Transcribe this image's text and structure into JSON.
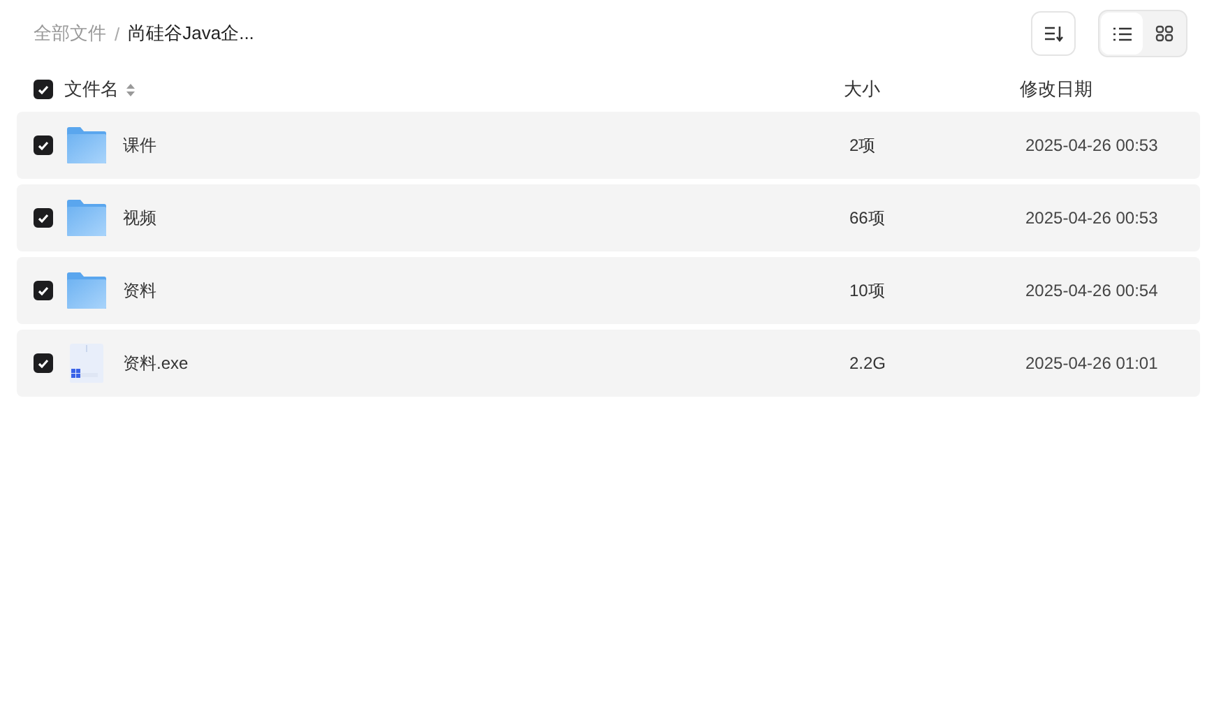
{
  "breadcrumb": [
    {
      "label": "全部文件",
      "current": false
    },
    {
      "label": "尚硅谷Java企...",
      "current": true
    }
  ],
  "breadcrumb_separator": "/",
  "view_modes": [
    {
      "kind": "list",
      "selected": true
    },
    {
      "kind": "grid",
      "selected": false
    }
  ],
  "table": {
    "select_all_checked": true,
    "columns": [
      {
        "label": "文件名",
        "sortable": true
      },
      {
        "label": "大小",
        "sortable": false
      },
      {
        "label": "修改日期",
        "sortable": false
      }
    ],
    "rows": [
      {
        "kind": "folder",
        "name": "课件",
        "size": "2项",
        "modified": "2025-04-26 00:53",
        "checked": true
      },
      {
        "kind": "folder",
        "name": "视频",
        "size": "66项",
        "modified": "2025-04-26 00:53",
        "checked": true
      },
      {
        "kind": "folder",
        "name": "资料",
        "size": "10项",
        "modified": "2025-04-26 00:54",
        "checked": true
      },
      {
        "kind": "exe",
        "name": "资料.exe",
        "size": "2.2G",
        "modified": "2025-04-26 01:01",
        "checked": true
      }
    ]
  }
}
